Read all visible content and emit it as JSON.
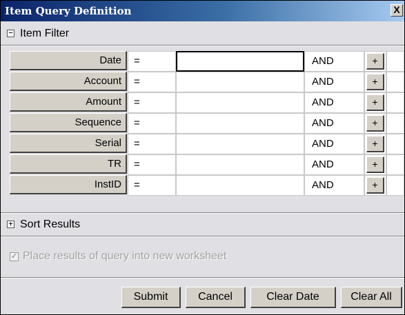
{
  "window": {
    "title": "Item Query Definition",
    "close_label": "X"
  },
  "item_filter": {
    "toggle_symbol": "−",
    "label": "Item Filter",
    "rows": [
      {
        "field": "Date",
        "operator": "=",
        "value": "",
        "conjunction": "AND",
        "add_label": "+"
      },
      {
        "field": "Account",
        "operator": "=",
        "value": "",
        "conjunction": "AND",
        "add_label": "+"
      },
      {
        "field": "Amount",
        "operator": "=",
        "value": "",
        "conjunction": "AND",
        "add_label": "+"
      },
      {
        "field": "Sequence",
        "operator": "=",
        "value": "",
        "conjunction": "AND",
        "add_label": "+"
      },
      {
        "field": "Serial",
        "operator": "=",
        "value": "",
        "conjunction": "AND",
        "add_label": "+"
      },
      {
        "field": "TR",
        "operator": "=",
        "value": "",
        "conjunction": "AND",
        "add_label": "+"
      },
      {
        "field": "InstID",
        "operator": "=",
        "value": "",
        "conjunction": "AND",
        "add_label": "+"
      }
    ]
  },
  "sort_results": {
    "toggle_symbol": "+",
    "label": "Sort Results"
  },
  "options": {
    "new_worksheet_label": "Place results of query into new worksheet",
    "new_worksheet_checked": true,
    "new_worksheet_enabled": false
  },
  "buttons": {
    "submit": "Submit",
    "cancel": "Cancel",
    "clear_date": "Clear Date",
    "clear_all": "Clear All"
  }
}
